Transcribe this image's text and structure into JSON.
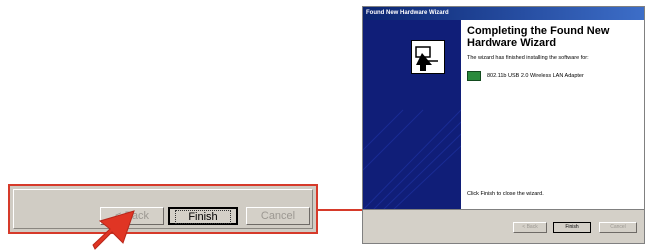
{
  "zoom": {
    "back_label": "< Back",
    "finish_label": "Finish",
    "cancel_label": "Cancel"
  },
  "wizard": {
    "title": "Found New Hardware Wizard",
    "heading_line1": "Completing the Found New",
    "heading_line2": "Hardware Wizard",
    "finished_text": "The wizard has finished installing the software for:",
    "device_name": "802.11b USB 2.0 Wireless LAN Adapter",
    "close_text": "Click Finish to close the wizard.",
    "back_label": "< Back",
    "finish_label": "Finish",
    "cancel_label": "Cancel"
  },
  "colors": {
    "highlight": "#d63a2a",
    "sidebar": "#101e78",
    "titlebar": "#0a2470"
  }
}
